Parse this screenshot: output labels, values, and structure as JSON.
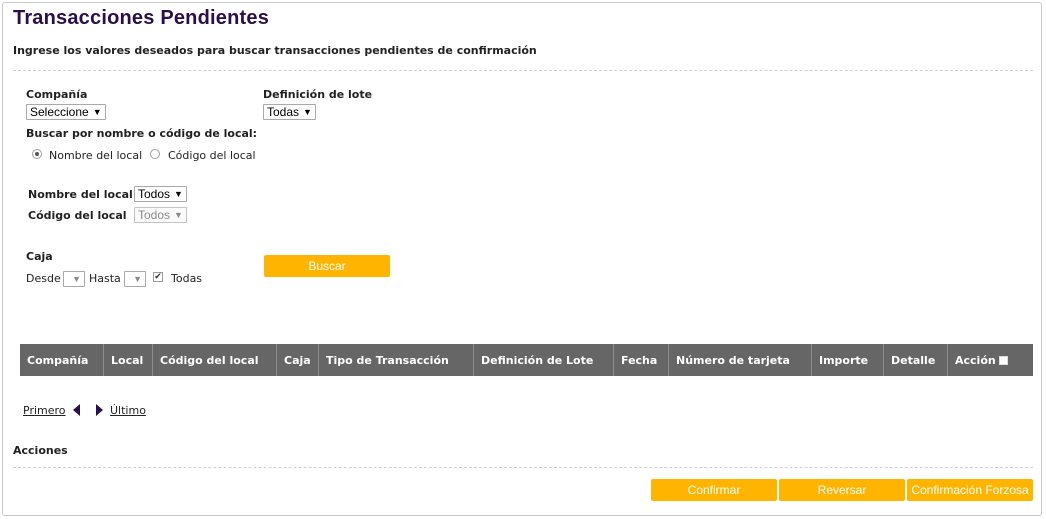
{
  "page": {
    "title": "Transacciones Pendientes",
    "subtitle": "Ingrese los valores deseados para buscar transacciones pendientes de confirmación"
  },
  "filters": {
    "company": {
      "label": "Compañía",
      "value": "Seleccione"
    },
    "batch_definition": {
      "label": "Definición de lote",
      "value": "Todas"
    },
    "search_by": {
      "label": "Buscar por nombre o código de local:",
      "options": [
        {
          "label": "Nombre del local",
          "selected": true
        },
        {
          "label": "Código del local",
          "selected": false
        }
      ]
    },
    "store_name": {
      "label": "Nombre del local",
      "value": "Todos"
    },
    "store_code": {
      "label": "Código del local",
      "value": "Todos"
    },
    "register": {
      "label": "Caja",
      "from_label": "Desde",
      "to_label": "Hasta",
      "all_label": "Todas",
      "all_checked": true
    },
    "search_button": "Buscar"
  },
  "table": {
    "columns": [
      "Compañía",
      "Local",
      "Código del local",
      "Caja",
      "Tipo de Transacción",
      "Definición de Lote",
      "Fecha",
      "Número de tarjeta",
      "Importe",
      "Detalle",
      "Acción"
    ],
    "rows": []
  },
  "pagination": {
    "first": "Primero",
    "last": "Último"
  },
  "actions": {
    "label": "Acciones",
    "confirm": "Confirmar",
    "reverse": "Reversar",
    "force_confirm": "Confirmación Forzosa"
  },
  "colors": {
    "accent": "#ffb400",
    "title": "#2b0f4a",
    "table_header": "#666666"
  }
}
